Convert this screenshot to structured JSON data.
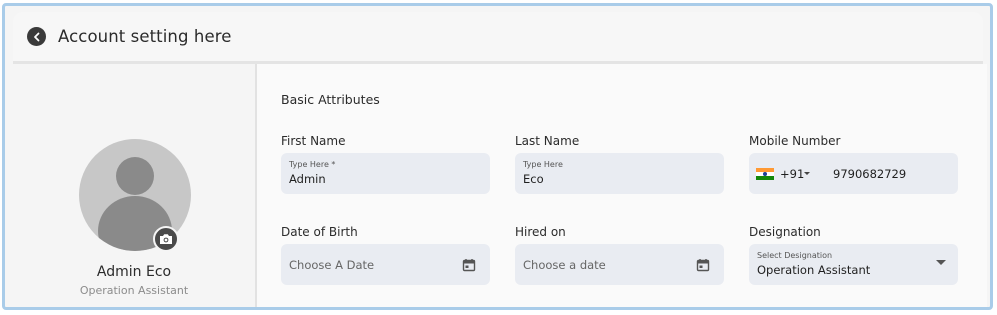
{
  "header": {
    "title": "Account setting here"
  },
  "profile": {
    "name": "Admin Eco",
    "role": "Operation Assistant"
  },
  "form": {
    "section_title": "Basic Attributes",
    "first_name": {
      "label": "First Name",
      "hint": "Type Here *",
      "value": "Admin"
    },
    "last_name": {
      "label": "Last Name",
      "hint": "Type Here",
      "value": "Eco"
    },
    "mobile": {
      "label": "Mobile Number",
      "country_code": "+91",
      "value": "9790682729"
    },
    "dob": {
      "label": "Date of Birth",
      "placeholder": "Choose A Date"
    },
    "hired_on": {
      "label": "Hired on",
      "placeholder": "Choose a date"
    },
    "designation": {
      "label": "Designation",
      "hint": "Select Designation",
      "value": "Operation Assistant"
    }
  },
  "colors": {
    "field_bg": "#e9ecf2",
    "flag_saffron": "#ff9933",
    "flag_green": "#138808",
    "frame_border": "#a9cce9"
  }
}
